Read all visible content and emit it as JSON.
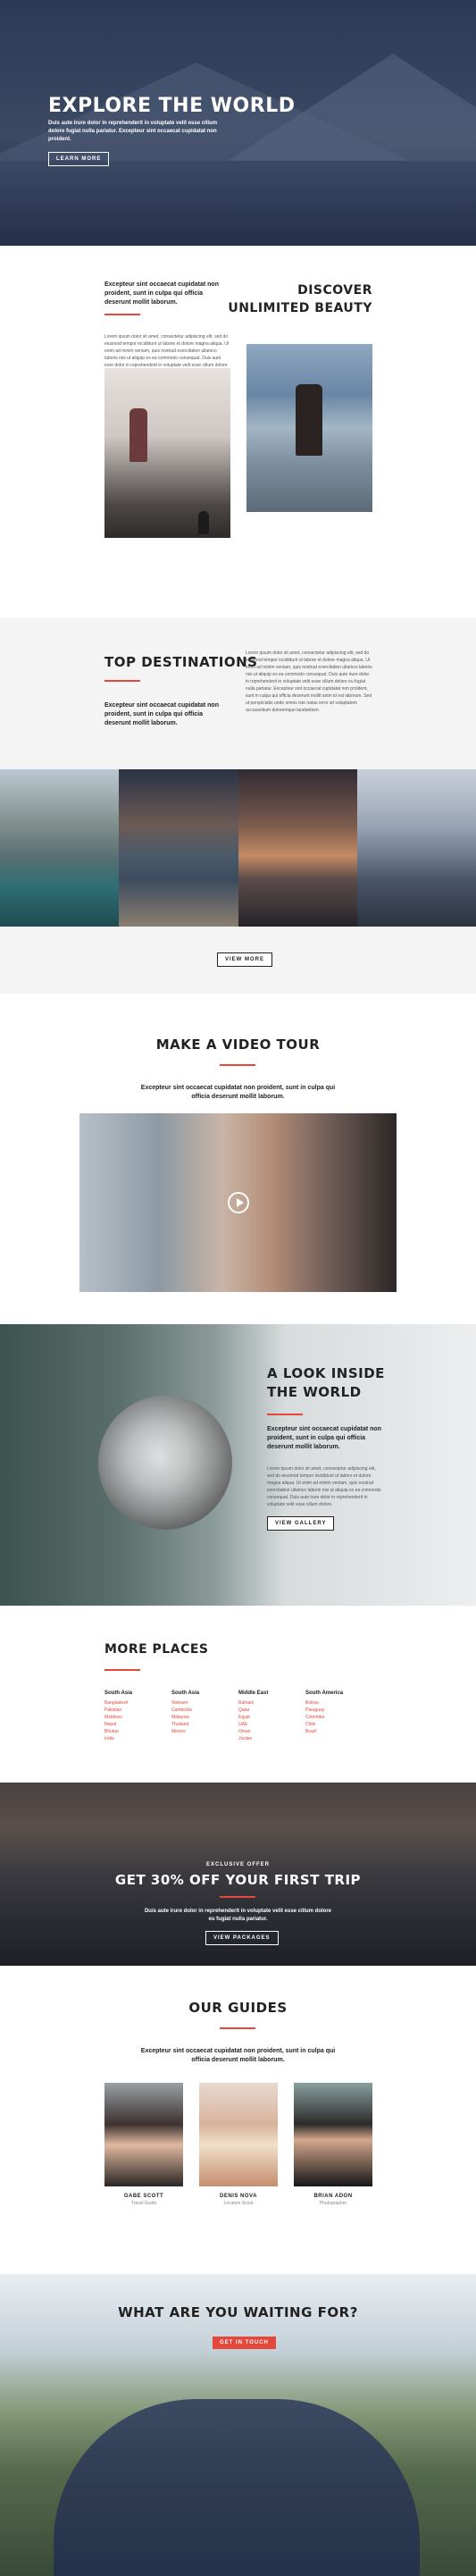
{
  "hero": {
    "title": "EXPLORE THE WORLD",
    "subtitle": "Duis aute irure dolor in reprehenderit in voluptate velit esse cillum dolore fugiat nulla pariatur. Excepteur sint occaecat cupidatat non proident.",
    "button": "LEARN MORE"
  },
  "discover": {
    "lead": "Excepteur sint occaecat cupidatat non proident, sunt in culpa qui officia deserunt mollit laborum.",
    "body": "Lorem ipsum dolor sit amet, consectetur adipiscing elit, sed do eiusmod tempor incididunt ut labore et dolore magna aliqua. Ut enim ad minim veniam, quis nostrud exercitation ullamco laboris nisi ut aliquip ex ea commodo consequat. Duis aute irure dolor in reprehenderit in voluptate velit esse cillum dolore eu fugiat nulla pariatur. Excepteur sint occaecat cupidatat non proident, sunt in culpa qui officia deserunt mollit anim id est laborum.",
    "title_line1": "DISCOVER",
    "title_line2": "UNLIMITED BEAUTY"
  },
  "destinations": {
    "title": "TOP DESTINATIONS",
    "lead": "Excepteur sint occaecat cupidatat non proident, sunt in culpa qui officia deserunt mollit laborum.",
    "body": "Lorem ipsum dolor sit amet, consectetur adipiscing elit, sed do eiusmod tempor incididunt ut labore et dolore magna aliqua. Ut enim ad minim veniam, quis nostrud exercitation ullamco laboris nisi ut aliquip ex ea commodo consequat. Duis aute irure dolor in reprehenderit in voluptate velit esse cillum dolore eu fugiat nulla pariatur. Excepteur sint occaecat cupidatat non proident, sunt in culpa qui officia deserunt mollit anim id est laborum. Sed ut perspiciatis unde omnis iste natus error sit voluptatem accusantium doloremque laudantium.",
    "button": "VIEW MORE"
  },
  "video": {
    "title": "MAKE A VIDEO TOUR",
    "lead": "Excepteur sint occaecat cupidatat non proident, sunt in culpa qui officia deserunt mollit laborum."
  },
  "look": {
    "title_line1": "A LOOK INSIDE",
    "title_line2": "THE WORLD",
    "lead": "Excepteur sint occaecat cupidatat non proident, sunt in culpa qui officia deserunt mollit laborum.",
    "body": "Lorem ipsum dolor sit amet, consectetur adipiscing elit, sed do eiusmod tempor incididunt ut labore et dolore magna aliqua. Ut enim ad minim veniam, quis nostrud exercitation ullamco laboris nisi ut aliquip ex ea commodo consequat. Duis aute irure dolor in reprehenderit in voluptate velit esse cillum dolore.",
    "button": "VIEW GALLERY"
  },
  "places": {
    "title": "MORE PLACES",
    "columns": [
      {
        "heading": "South Asia",
        "items": [
          "Bangladesh",
          "Pakistan",
          "Maldives",
          "Nepal",
          "Bhutan",
          "India"
        ]
      },
      {
        "heading": "South Asia",
        "items": [
          "Vietnam",
          "Cambodia",
          "Malaysia",
          "Thailand",
          "Mexico"
        ]
      },
      {
        "heading": "Middle East",
        "items": [
          "Bahrain",
          "Qatar",
          "Egypt",
          "UAE",
          "Oman",
          "Jordan"
        ]
      },
      {
        "heading": "South America",
        "items": [
          "Bolivia",
          "Paraguay",
          "Colombia",
          "Chile",
          "Brazil"
        ]
      }
    ]
  },
  "offer": {
    "eyebrow": "EXCLUSIVE OFFER",
    "title": "GET 30% OFF YOUR FIRST TRIP",
    "subtitle": "Duis aute irure dolor in reprehenderit in voluptate velit esse cillum dolore eu fugiat nulla pariatur.",
    "button": "VIEW PACKAGES"
  },
  "guides": {
    "title": "OUR GUIDES",
    "lead": "Excepteur sint occaecat cupidatat non proident, sunt in culpa qui officia deserunt mollit laborum.",
    "people": [
      {
        "name": "GABE SCOTT",
        "role": "Travel Guide"
      },
      {
        "name": "DENIS NOVA",
        "role": "Location Scout"
      },
      {
        "name": "BRIAN ADON",
        "role": "Photographer"
      }
    ]
  },
  "cta": {
    "title": "WHAT ARE YOU WAITING FOR?",
    "button": "GET IN TOUCH"
  }
}
